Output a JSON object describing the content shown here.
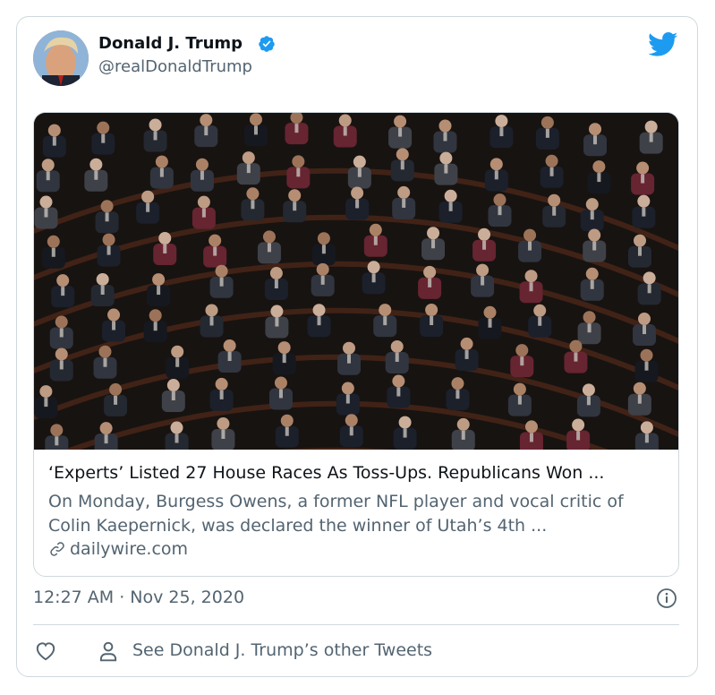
{
  "author": {
    "name": "Donald J. Trump",
    "handle": "@realDonaldTrump",
    "verified": true
  },
  "link_card": {
    "headline": "‘Experts’ Listed 27 House Races As Toss-Ups. Republicans Won ...",
    "description": "On Monday, Burgess Owens, a former NFL player and vocal critic of Colin Kaepernick, was declared the winner of Utah’s 4th ...",
    "domain": "dailywire.com"
  },
  "meta": {
    "timestamp": "12:27 AM · Nov 25, 2020"
  },
  "actions": {
    "see_other": "See Donald J. Trump’s other Tweets"
  },
  "colors": {
    "brand": "#1d9bf0",
    "text": "#0f1419",
    "secondary": "#536471",
    "border": "#cfd9de"
  },
  "icons": [
    "twitter-bird-icon",
    "verified-badge-icon",
    "link-icon",
    "info-icon",
    "heart-icon",
    "person-icon"
  ]
}
